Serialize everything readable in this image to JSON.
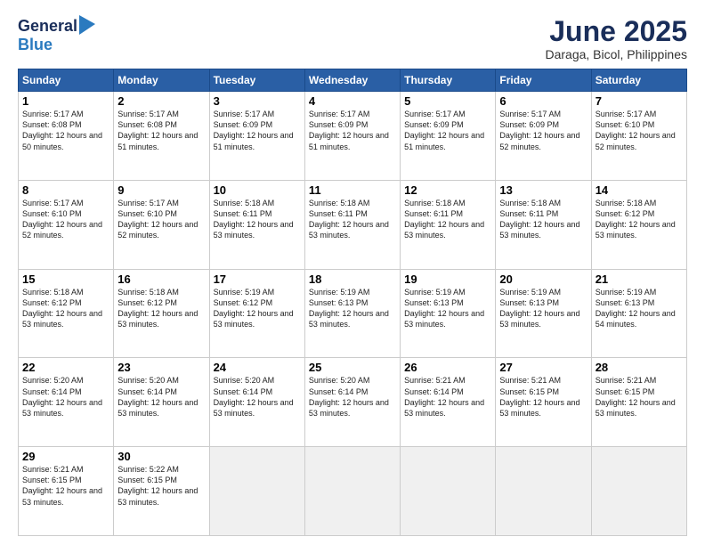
{
  "header": {
    "logo_general": "General",
    "logo_blue": "Blue",
    "month_title": "June 2025",
    "location": "Daraga, Bicol, Philippines"
  },
  "calendar": {
    "days_of_week": [
      "Sunday",
      "Monday",
      "Tuesday",
      "Wednesday",
      "Thursday",
      "Friday",
      "Saturday"
    ],
    "weeks": [
      [
        {
          "day": "",
          "empty": true
        },
        {
          "day": "",
          "empty": true
        },
        {
          "day": "",
          "empty": true
        },
        {
          "day": "",
          "empty": true
        },
        {
          "day": "",
          "empty": true
        },
        {
          "day": "",
          "empty": true
        },
        {
          "day": "",
          "empty": true
        }
      ]
    ],
    "cells": [
      {
        "day": 1,
        "sunrise": "5:17 AM",
        "sunset": "6:08 PM",
        "daylight": "12 hours and 50 minutes."
      },
      {
        "day": 2,
        "sunrise": "5:17 AM",
        "sunset": "6:08 PM",
        "daylight": "12 hours and 51 minutes."
      },
      {
        "day": 3,
        "sunrise": "5:17 AM",
        "sunset": "6:09 PM",
        "daylight": "12 hours and 51 minutes."
      },
      {
        "day": 4,
        "sunrise": "5:17 AM",
        "sunset": "6:09 PM",
        "daylight": "12 hours and 51 minutes."
      },
      {
        "day": 5,
        "sunrise": "5:17 AM",
        "sunset": "6:09 PM",
        "daylight": "12 hours and 51 minutes."
      },
      {
        "day": 6,
        "sunrise": "5:17 AM",
        "sunset": "6:09 PM",
        "daylight": "12 hours and 52 minutes."
      },
      {
        "day": 7,
        "sunrise": "5:17 AM",
        "sunset": "6:10 PM",
        "daylight": "12 hours and 52 minutes."
      },
      {
        "day": 8,
        "sunrise": "5:17 AM",
        "sunset": "6:10 PM",
        "daylight": "12 hours and 52 minutes."
      },
      {
        "day": 9,
        "sunrise": "5:17 AM",
        "sunset": "6:10 PM",
        "daylight": "12 hours and 52 minutes."
      },
      {
        "day": 10,
        "sunrise": "5:18 AM",
        "sunset": "6:11 PM",
        "daylight": "12 hours and 53 minutes."
      },
      {
        "day": 11,
        "sunrise": "5:18 AM",
        "sunset": "6:11 PM",
        "daylight": "12 hours and 53 minutes."
      },
      {
        "day": 12,
        "sunrise": "5:18 AM",
        "sunset": "6:11 PM",
        "daylight": "12 hours and 53 minutes."
      },
      {
        "day": 13,
        "sunrise": "5:18 AM",
        "sunset": "6:11 PM",
        "daylight": "12 hours and 53 minutes."
      },
      {
        "day": 14,
        "sunrise": "5:18 AM",
        "sunset": "6:12 PM",
        "daylight": "12 hours and 53 minutes."
      },
      {
        "day": 15,
        "sunrise": "5:18 AM",
        "sunset": "6:12 PM",
        "daylight": "12 hours and 53 minutes."
      },
      {
        "day": 16,
        "sunrise": "5:18 AM",
        "sunset": "6:12 PM",
        "daylight": "12 hours and 53 minutes."
      },
      {
        "day": 17,
        "sunrise": "5:19 AM",
        "sunset": "6:12 PM",
        "daylight": "12 hours and 53 minutes."
      },
      {
        "day": 18,
        "sunrise": "5:19 AM",
        "sunset": "6:13 PM",
        "daylight": "12 hours and 53 minutes."
      },
      {
        "day": 19,
        "sunrise": "5:19 AM",
        "sunset": "6:13 PM",
        "daylight": "12 hours and 53 minutes."
      },
      {
        "day": 20,
        "sunrise": "5:19 AM",
        "sunset": "6:13 PM",
        "daylight": "12 hours and 53 minutes."
      },
      {
        "day": 21,
        "sunrise": "5:19 AM",
        "sunset": "6:13 PM",
        "daylight": "12 hours and 54 minutes."
      },
      {
        "day": 22,
        "sunrise": "5:20 AM",
        "sunset": "6:14 PM",
        "daylight": "12 hours and 53 minutes."
      },
      {
        "day": 23,
        "sunrise": "5:20 AM",
        "sunset": "6:14 PM",
        "daylight": "12 hours and 53 minutes."
      },
      {
        "day": 24,
        "sunrise": "5:20 AM",
        "sunset": "6:14 PM",
        "daylight": "12 hours and 53 minutes."
      },
      {
        "day": 25,
        "sunrise": "5:20 AM",
        "sunset": "6:14 PM",
        "daylight": "12 hours and 53 minutes."
      },
      {
        "day": 26,
        "sunrise": "5:21 AM",
        "sunset": "6:14 PM",
        "daylight": "12 hours and 53 minutes."
      },
      {
        "day": 27,
        "sunrise": "5:21 AM",
        "sunset": "6:15 PM",
        "daylight": "12 hours and 53 minutes."
      },
      {
        "day": 28,
        "sunrise": "5:21 AM",
        "sunset": "6:15 PM",
        "daylight": "12 hours and 53 minutes."
      },
      {
        "day": 29,
        "sunrise": "5:21 AM",
        "sunset": "6:15 PM",
        "daylight": "12 hours and 53 minutes."
      },
      {
        "day": 30,
        "sunrise": "5:22 AM",
        "sunset": "6:15 PM",
        "daylight": "12 hours and 53 minutes."
      }
    ]
  }
}
